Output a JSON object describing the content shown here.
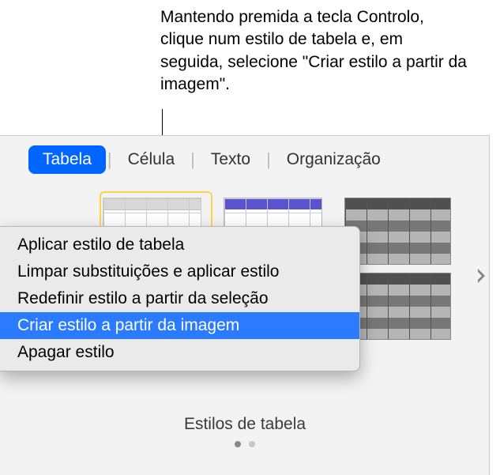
{
  "callout": "Mantendo premida a tecla Controlo, clique num estilo de tabela e, em seguida, selecione \"Criar estilo a partir da imagem\".",
  "tabs": {
    "items": [
      {
        "label": "Tabela",
        "active": true
      },
      {
        "label": "Célula",
        "active": false
      },
      {
        "label": "Texto",
        "active": false
      },
      {
        "label": "Organização",
        "active": false
      }
    ]
  },
  "context_menu": {
    "items": [
      {
        "label": "Aplicar estilo de tabela",
        "highlighted": false
      },
      {
        "label": "Limpar substituições e aplicar estilo",
        "highlighted": false
      },
      {
        "label": "Redefinir estilo a partir da seleção",
        "highlighted": false
      },
      {
        "label": "Criar estilo a partir da imagem",
        "highlighted": true
      },
      {
        "label": "Apagar estilo",
        "highlighted": false
      }
    ]
  },
  "styles_section_label": "Estilos de tabela",
  "icons": {
    "chevron_right": "chevron-right-icon"
  }
}
